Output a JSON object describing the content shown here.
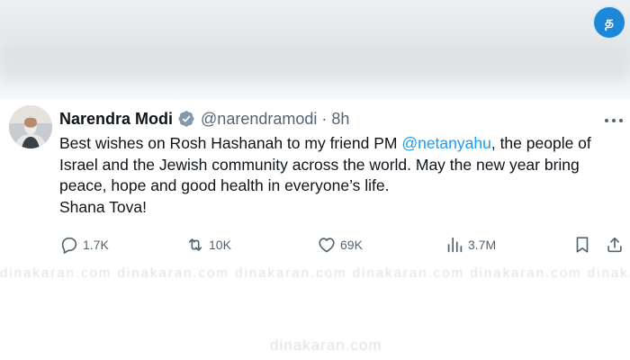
{
  "site": {
    "logo_char": "த",
    "watermark": "dinakaran.com"
  },
  "tweet": {
    "author": {
      "display_name": "Narendra Modi",
      "handle": "@narendramodi",
      "separator": "·",
      "time": "8h",
      "verified": true,
      "verified_color": "#829aab"
    },
    "body": {
      "part1": "Best wishes on Rosh Hashanah to my friend PM ",
      "mention": "@netanyahu",
      "part2": ", the people of Israel and the Jewish community across the world. May the new year bring peace, hope and good health in everyone’s life.",
      "line2": "Shana Tova!",
      "mention_color": "#1d9bf0"
    },
    "actions": {
      "replies": "1.7K",
      "reposts": "10K",
      "likes": "69K",
      "views": "3.7M"
    }
  },
  "icons": [
    "more-icon",
    "verified-icon",
    "reply-icon",
    "repost-icon",
    "like-icon",
    "views-icon",
    "bookmark-icon",
    "share-icon"
  ]
}
